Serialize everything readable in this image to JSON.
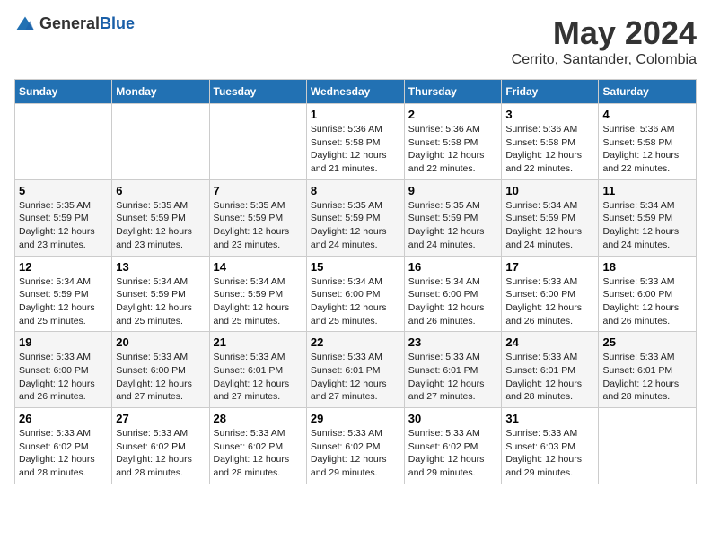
{
  "logo": {
    "general": "General",
    "blue": "Blue"
  },
  "header": {
    "month": "May 2024",
    "location": "Cerrito, Santander, Colombia"
  },
  "weekdays": [
    "Sunday",
    "Monday",
    "Tuesday",
    "Wednesday",
    "Thursday",
    "Friday",
    "Saturday"
  ],
  "weeks": [
    [
      {
        "day": "",
        "sunrise": "",
        "sunset": "",
        "daylight": ""
      },
      {
        "day": "",
        "sunrise": "",
        "sunset": "",
        "daylight": ""
      },
      {
        "day": "",
        "sunrise": "",
        "sunset": "",
        "daylight": ""
      },
      {
        "day": "1",
        "sunrise": "Sunrise: 5:36 AM",
        "sunset": "Sunset: 5:58 PM",
        "daylight": "Daylight: 12 hours and 21 minutes."
      },
      {
        "day": "2",
        "sunrise": "Sunrise: 5:36 AM",
        "sunset": "Sunset: 5:58 PM",
        "daylight": "Daylight: 12 hours and 22 minutes."
      },
      {
        "day": "3",
        "sunrise": "Sunrise: 5:36 AM",
        "sunset": "Sunset: 5:58 PM",
        "daylight": "Daylight: 12 hours and 22 minutes."
      },
      {
        "day": "4",
        "sunrise": "Sunrise: 5:36 AM",
        "sunset": "Sunset: 5:58 PM",
        "daylight": "Daylight: 12 hours and 22 minutes."
      }
    ],
    [
      {
        "day": "5",
        "sunrise": "Sunrise: 5:35 AM",
        "sunset": "Sunset: 5:59 PM",
        "daylight": "Daylight: 12 hours and 23 minutes."
      },
      {
        "day": "6",
        "sunrise": "Sunrise: 5:35 AM",
        "sunset": "Sunset: 5:59 PM",
        "daylight": "Daylight: 12 hours and 23 minutes."
      },
      {
        "day": "7",
        "sunrise": "Sunrise: 5:35 AM",
        "sunset": "Sunset: 5:59 PM",
        "daylight": "Daylight: 12 hours and 23 minutes."
      },
      {
        "day": "8",
        "sunrise": "Sunrise: 5:35 AM",
        "sunset": "Sunset: 5:59 PM",
        "daylight": "Daylight: 12 hours and 24 minutes."
      },
      {
        "day": "9",
        "sunrise": "Sunrise: 5:35 AM",
        "sunset": "Sunset: 5:59 PM",
        "daylight": "Daylight: 12 hours and 24 minutes."
      },
      {
        "day": "10",
        "sunrise": "Sunrise: 5:34 AM",
        "sunset": "Sunset: 5:59 PM",
        "daylight": "Daylight: 12 hours and 24 minutes."
      },
      {
        "day": "11",
        "sunrise": "Sunrise: 5:34 AM",
        "sunset": "Sunset: 5:59 PM",
        "daylight": "Daylight: 12 hours and 24 minutes."
      }
    ],
    [
      {
        "day": "12",
        "sunrise": "Sunrise: 5:34 AM",
        "sunset": "Sunset: 5:59 PM",
        "daylight": "Daylight: 12 hours and 25 minutes."
      },
      {
        "day": "13",
        "sunrise": "Sunrise: 5:34 AM",
        "sunset": "Sunset: 5:59 PM",
        "daylight": "Daylight: 12 hours and 25 minutes."
      },
      {
        "day": "14",
        "sunrise": "Sunrise: 5:34 AM",
        "sunset": "Sunset: 5:59 PM",
        "daylight": "Daylight: 12 hours and 25 minutes."
      },
      {
        "day": "15",
        "sunrise": "Sunrise: 5:34 AM",
        "sunset": "Sunset: 6:00 PM",
        "daylight": "Daylight: 12 hours and 25 minutes."
      },
      {
        "day": "16",
        "sunrise": "Sunrise: 5:34 AM",
        "sunset": "Sunset: 6:00 PM",
        "daylight": "Daylight: 12 hours and 26 minutes."
      },
      {
        "day": "17",
        "sunrise": "Sunrise: 5:33 AM",
        "sunset": "Sunset: 6:00 PM",
        "daylight": "Daylight: 12 hours and 26 minutes."
      },
      {
        "day": "18",
        "sunrise": "Sunrise: 5:33 AM",
        "sunset": "Sunset: 6:00 PM",
        "daylight": "Daylight: 12 hours and 26 minutes."
      }
    ],
    [
      {
        "day": "19",
        "sunrise": "Sunrise: 5:33 AM",
        "sunset": "Sunset: 6:00 PM",
        "daylight": "Daylight: 12 hours and 26 minutes."
      },
      {
        "day": "20",
        "sunrise": "Sunrise: 5:33 AM",
        "sunset": "Sunset: 6:00 PM",
        "daylight": "Daylight: 12 hours and 27 minutes."
      },
      {
        "day": "21",
        "sunrise": "Sunrise: 5:33 AM",
        "sunset": "Sunset: 6:01 PM",
        "daylight": "Daylight: 12 hours and 27 minutes."
      },
      {
        "day": "22",
        "sunrise": "Sunrise: 5:33 AM",
        "sunset": "Sunset: 6:01 PM",
        "daylight": "Daylight: 12 hours and 27 minutes."
      },
      {
        "day": "23",
        "sunrise": "Sunrise: 5:33 AM",
        "sunset": "Sunset: 6:01 PM",
        "daylight": "Daylight: 12 hours and 27 minutes."
      },
      {
        "day": "24",
        "sunrise": "Sunrise: 5:33 AM",
        "sunset": "Sunset: 6:01 PM",
        "daylight": "Daylight: 12 hours and 28 minutes."
      },
      {
        "day": "25",
        "sunrise": "Sunrise: 5:33 AM",
        "sunset": "Sunset: 6:01 PM",
        "daylight": "Daylight: 12 hours and 28 minutes."
      }
    ],
    [
      {
        "day": "26",
        "sunrise": "Sunrise: 5:33 AM",
        "sunset": "Sunset: 6:02 PM",
        "daylight": "Daylight: 12 hours and 28 minutes."
      },
      {
        "day": "27",
        "sunrise": "Sunrise: 5:33 AM",
        "sunset": "Sunset: 6:02 PM",
        "daylight": "Daylight: 12 hours and 28 minutes."
      },
      {
        "day": "28",
        "sunrise": "Sunrise: 5:33 AM",
        "sunset": "Sunset: 6:02 PM",
        "daylight": "Daylight: 12 hours and 28 minutes."
      },
      {
        "day": "29",
        "sunrise": "Sunrise: 5:33 AM",
        "sunset": "Sunset: 6:02 PM",
        "daylight": "Daylight: 12 hours and 29 minutes."
      },
      {
        "day": "30",
        "sunrise": "Sunrise: 5:33 AM",
        "sunset": "Sunset: 6:02 PM",
        "daylight": "Daylight: 12 hours and 29 minutes."
      },
      {
        "day": "31",
        "sunrise": "Sunrise: 5:33 AM",
        "sunset": "Sunset: 6:03 PM",
        "daylight": "Daylight: 12 hours and 29 minutes."
      },
      {
        "day": "",
        "sunrise": "",
        "sunset": "",
        "daylight": ""
      }
    ]
  ]
}
